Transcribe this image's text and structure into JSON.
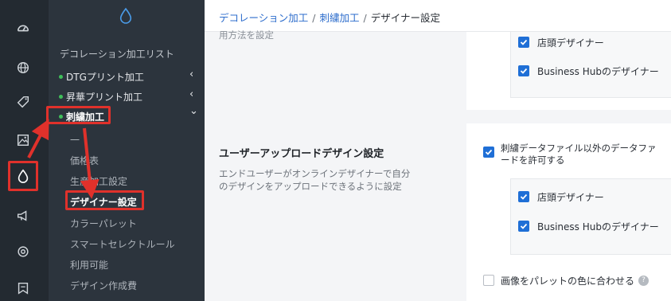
{
  "breadcrumb": {
    "item1": "デコレーション加工",
    "item2": "刺繍加工",
    "current": "デザイナー設定",
    "separator": "/"
  },
  "subnav": {
    "section_title": "デコレーション加工リスト",
    "items": [
      {
        "label": "DTGプリント加工",
        "chevron": "‹"
      },
      {
        "label": "昇華プリント加工",
        "chevron": "‹"
      },
      {
        "label": "刺繍加工",
        "chevron": "⌄"
      }
    ],
    "sub_items": [
      "一",
      "価格表",
      "生産加工設定",
      "デザイナー設定",
      "カラーパレット",
      "スマートセレクトルール",
      "利用可能",
      "デザイン作成費"
    ]
  },
  "top_section": {
    "desc_cut": "用方法を設定",
    "checkbox1": "店頭デザイナー",
    "checkbox2": "Business Hubのデザイナー"
  },
  "upload_section": {
    "title": "ユーザーアップロードデザイン設定",
    "desc_line1": "エンドユーザーがオンラインデザイナーで自分",
    "desc_line2": "のデザインをアップロードできるように設定",
    "allow_line1": "刺繍データファイル以外のデータファ",
    "allow_line2": "ードを許可する",
    "checkbox1": "店頭デザイナー",
    "checkbox2": "Business Hubのデザイナー",
    "palette_label": "画像をパレットの色に合わせる",
    "help_glyph": "?"
  },
  "colors": {
    "rail_bg": "#232a31",
    "subnav_bg": "#2c343d",
    "accent_blue": "#1f6fd6",
    "highlight_red": "#e0312b",
    "status_green": "#3fbf5a"
  }
}
